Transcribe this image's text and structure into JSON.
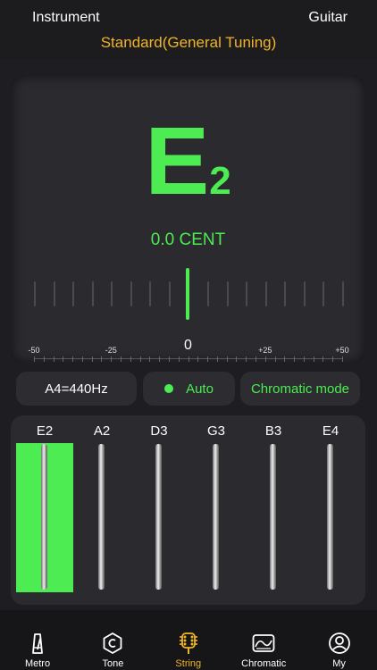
{
  "header": {
    "left_label": "Instrument",
    "right_label": "Guitar",
    "tuning_label": "Standard(General Tuning)"
  },
  "tuner": {
    "note_letter": "E",
    "note_octave": "2",
    "cents_readout": "0.0 CENT",
    "scale_labels": [
      "-50",
      "-25",
      "0",
      "+25",
      "+50"
    ]
  },
  "controls": {
    "reference_pitch": "A4=440Hz",
    "auto_label": "Auto",
    "mode_label": "Chromatic mode"
  },
  "strings": [
    {
      "label": "E2",
      "active": true
    },
    {
      "label": "A2",
      "active": false
    },
    {
      "label": "D3",
      "active": false
    },
    {
      "label": "G3",
      "active": false
    },
    {
      "label": "B3",
      "active": false
    },
    {
      "label": "E4",
      "active": false
    }
  ],
  "tabbar": {
    "items": [
      {
        "label": "Metro",
        "icon": "metronome-icon",
        "active": false
      },
      {
        "label": "Tone",
        "icon": "tone-c-icon",
        "active": false
      },
      {
        "label": "String",
        "icon": "guitar-headstock-icon",
        "active": true
      },
      {
        "label": "Chromatic",
        "icon": "chromatic-icon",
        "active": false
      },
      {
        "label": "My",
        "icon": "user-icon",
        "active": false
      }
    ]
  },
  "colors": {
    "accent_green": "#4cec52",
    "accent_orange": "#f0b429",
    "background": "#1e1e22"
  }
}
